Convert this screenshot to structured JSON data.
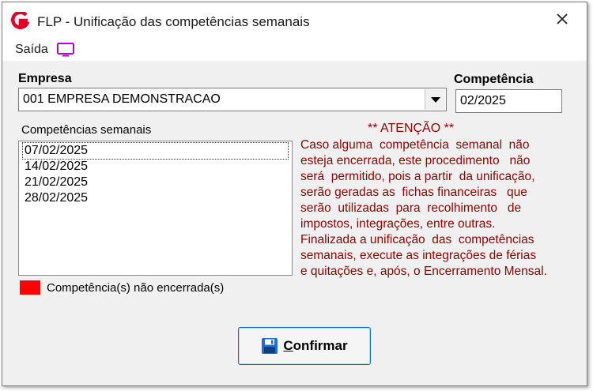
{
  "window": {
    "title": "FLP - Unificação das competências semanais",
    "close_icon": "close-icon",
    "logo_icon": "app-logo-icon",
    "logo_color": "#e0002a"
  },
  "menu": {
    "exit_label": "Saída",
    "exit_icon": "monitor-icon",
    "exit_icon_color": "#b000d0"
  },
  "empresa": {
    "label": "Empresa",
    "selected": "001 EMPRESA DEMONSTRACAO"
  },
  "competencia": {
    "label": "Competência",
    "value": "02/2025"
  },
  "weekly": {
    "label": "Competências semanais",
    "items": [
      "07/02/2025",
      "14/02/2025",
      "21/02/2025",
      "28/02/2025"
    ],
    "selected_index": 0
  },
  "attention": {
    "title": "** ATENÇÃO **",
    "lines": [
      "Caso alguma  competência  semanal  não",
      "esteja encerrada, este procedimento   não",
      "será  permitido, pois a partir  da unificação,",
      "serão geradas as  fichas financeiras   que",
      "serão  utilizadas  para  recolhimento   de",
      "impostos, integrações, entre outras.",
      "Finalizada a unificação  das  competências",
      "semanais, execute as integrações de férias",
      "e quitações e, após, o Encerramento Mensal."
    ],
    "color": "#8b0000"
  },
  "legend": {
    "label": "Competência(s) não encerrada(s)",
    "color": "#ff0000"
  },
  "confirm": {
    "mnemonic": "C",
    "rest": "onfirmar",
    "icon": "save-icon"
  }
}
